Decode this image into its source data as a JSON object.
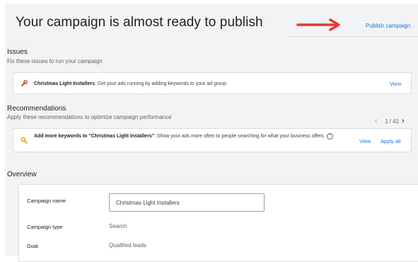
{
  "header": {
    "title": "Your campaign is almost ready to publish",
    "publish_label": "Publish campaign"
  },
  "issues": {
    "heading": "Issues",
    "subheading": "Fix these issues to run your campaign",
    "items": [
      {
        "title": "Christmas Light Installers",
        "text": ": Get your ads running by adding keywords to your ad group",
        "action": "View",
        "icon": "wrench-icon",
        "icon_color": "#d93025"
      }
    ]
  },
  "recommendations": {
    "heading": "Recommendations",
    "subheading": "Apply these recommendations to optimize campaign performance",
    "pager": "1 / 41",
    "items": [
      {
        "title": "Add more keywords to \"Christmas Light Installers\"",
        "text": ": Show your ads more often to people searching for what your business offers",
        "view": "View",
        "apply": "Apply all",
        "icon": "search-icon",
        "icon_color": "#f29900"
      }
    ]
  },
  "overview": {
    "heading": "Overview",
    "rows": [
      {
        "label": "Campaign name",
        "value": "Christmas Light Installers"
      },
      {
        "label": "Campaign type",
        "value": "Search"
      },
      {
        "label": "Goal",
        "value": "Qualified leads"
      }
    ]
  },
  "colors": {
    "accent": "#1a73e8",
    "arrow": "#e53935",
    "panel_bg": "#f1f3f4"
  }
}
